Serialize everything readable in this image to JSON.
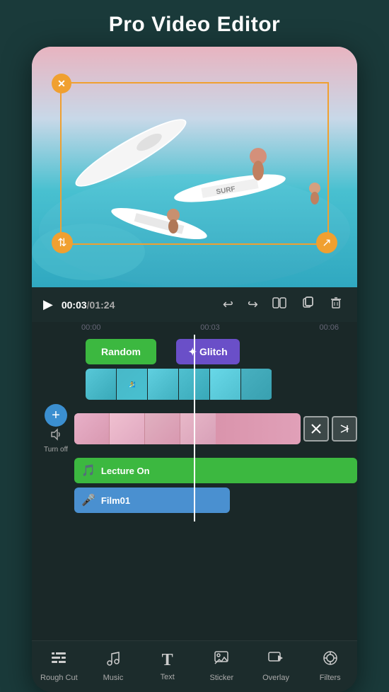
{
  "app": {
    "title": "Pro Video Editor"
  },
  "controls": {
    "time_current": "00:03",
    "time_separator": "/",
    "time_total": "01:24",
    "undo_icon": "↩",
    "redo_icon": "↪",
    "split_icon": "⧉",
    "copy_icon": "⧉",
    "delete_icon": "🗑"
  },
  "ruler": {
    "marks": [
      "00:00",
      "00:03",
      "00:06"
    ]
  },
  "tracks": {
    "effect_random": "Random",
    "effect_glitch": "✦ Glitch",
    "audio_label": "Turn off",
    "lecture_label": "Lecture On",
    "voice_label": "Film01"
  },
  "nav": {
    "items": [
      {
        "id": "rough-cut",
        "icon": "☰",
        "label": "Rough Cut"
      },
      {
        "id": "music",
        "icon": "♫",
        "label": "Music"
      },
      {
        "id": "text",
        "icon": "T",
        "label": "Text"
      },
      {
        "id": "sticker",
        "icon": "🖼",
        "label": "Sticker"
      },
      {
        "id": "overlay",
        "icon": "▶",
        "label": "Overlay"
      },
      {
        "id": "filters",
        "icon": "◎",
        "label": "Filters"
      }
    ]
  }
}
